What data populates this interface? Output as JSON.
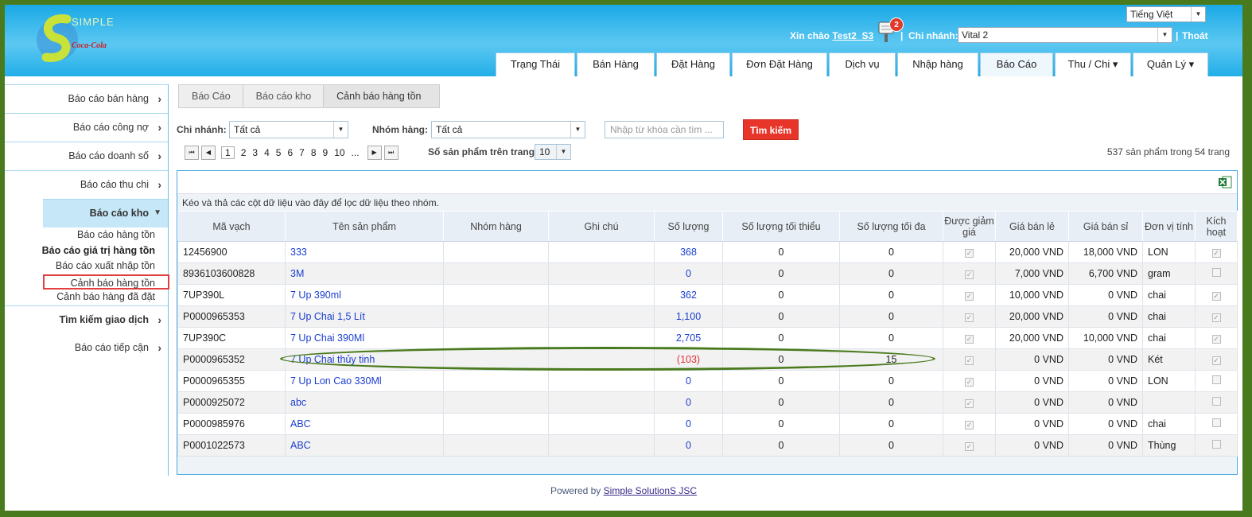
{
  "header": {
    "logo_text": "SIMPLE",
    "logo_sub": "Coca-Cola",
    "language": "Tiếng Việt",
    "greeting": "Xin chào",
    "user": "Test2_S3",
    "notifications": "2",
    "separator": "|",
    "branch_label": "Chi nhánh:",
    "branch_value": "Vital 2",
    "logout": "Thoát"
  },
  "nav": {
    "tabs": [
      {
        "label": "Trạng Thái"
      },
      {
        "label": "Bán Hàng"
      },
      {
        "label": "Đặt Hàng"
      },
      {
        "label": "Đơn Đặt Hàng"
      },
      {
        "label": "Dịch vụ"
      },
      {
        "label": "Nhập hàng"
      },
      {
        "label": "Báo Cáo"
      },
      {
        "label": "Thu / Chi ▾"
      },
      {
        "label": "Quản Lý ▾"
      }
    ]
  },
  "sidebar": {
    "items": [
      {
        "label": "Báo cáo bán hàng"
      },
      {
        "label": "Báo cáo công nợ"
      },
      {
        "label": "Báo cáo doanh số"
      },
      {
        "label": "Báo cáo thu chi"
      },
      {
        "label": "Báo cáo kho"
      },
      {
        "label": "Tìm kiếm giao dịch"
      },
      {
        "label": "Báo cáo tiếp cận"
      }
    ],
    "sub_items": [
      {
        "label": "Báo cáo hàng tồn"
      },
      {
        "label": "Báo cáo giá trị hàng tồn"
      },
      {
        "label": "Báo cáo xuất nhập tồn"
      },
      {
        "label": "Cảnh báo hàng tồn"
      },
      {
        "label": "Cảnh báo hàng đã đặt"
      }
    ]
  },
  "breadcrumb": [
    "Báo Cáo",
    "Báo cáo kho",
    "Cảnh báo hàng tồn"
  ],
  "filters": {
    "branch_label": "Chi nhánh:",
    "branch_value": "Tất cả",
    "group_label": "Nhóm hàng:",
    "group_value": "Tất cả",
    "keyword_placeholder": "Nhập từ khóa cần tìm ...",
    "search_button": "Tìm kiếm"
  },
  "pager": {
    "pages": [
      "1",
      "2",
      "3",
      "4",
      "5",
      "6",
      "7",
      "8",
      "9",
      "10",
      "..."
    ],
    "current": "1",
    "per_page_label": "Số sản phẩm trên trang:",
    "per_page_value": "10",
    "total": "537 sản phẩm trong 54 trang"
  },
  "grid": {
    "group_hint": "Kéo và thả các cột dữ liệu vào đây để lọc dữ liệu theo nhóm.",
    "columns": [
      "Mã vạch",
      "Tên sản phẩm",
      "Nhóm hàng",
      "Ghi chú",
      "Số lượng",
      "Số lượng tối thiểu",
      "Số lượng tối đa",
      "Được giảm giá",
      "Giá bán lẻ",
      "Giá bán sỉ",
      "Đơn vị tính",
      "Kích hoạt"
    ],
    "rows": [
      {
        "barcode": "12456900",
        "name": "333",
        "group": "",
        "note": "",
        "qty": "368",
        "min": "0",
        "max": "0",
        "discount": true,
        "retail": "20,000 VND",
        "wholesale": "18,000 VND",
        "unit": "LON",
        "active": true
      },
      {
        "barcode": "8936103600828",
        "name": "3M",
        "group": "",
        "note": "",
        "qty": "0",
        "min": "0",
        "max": "0",
        "discount": true,
        "retail": "7,000 VND",
        "wholesale": "6,700 VND",
        "unit": "gram",
        "active": false
      },
      {
        "barcode": "7UP390L",
        "name": "7 Up 390ml",
        "group": "",
        "note": "",
        "qty": "362",
        "min": "0",
        "max": "0",
        "discount": true,
        "retail": "10,000 VND",
        "wholesale": "0 VND",
        "unit": "chai",
        "active": true
      },
      {
        "barcode": "P0000965353",
        "name": "7 Up Chai 1,5 Lít",
        "group": "",
        "note": "",
        "qty": "1,100",
        "min": "0",
        "max": "0",
        "discount": true,
        "retail": "20,000 VND",
        "wholesale": "0 VND",
        "unit": "chai",
        "active": true
      },
      {
        "barcode": "7UP390C",
        "name": "7 Up Chai 390Ml",
        "group": "",
        "note": "",
        "qty": "2,705",
        "min": "0",
        "max": "0",
        "discount": true,
        "retail": "20,000 VND",
        "wholesale": "10,000 VND",
        "unit": "chai",
        "active": true
      },
      {
        "barcode": "P0000965352",
        "name": "7 Up Chai thủy tinh",
        "group": "",
        "note": "",
        "qty": "(103)",
        "min": "0",
        "max": "15",
        "discount": true,
        "retail": "0 VND",
        "wholesale": "0 VND",
        "unit": "Két",
        "active": true
      },
      {
        "barcode": "P0000965355",
        "name": "7 Up Lon Cao 330Ml",
        "group": "",
        "note": "",
        "qty": "0",
        "min": "0",
        "max": "0",
        "discount": true,
        "retail": "0 VND",
        "wholesale": "0 VND",
        "unit": "LON",
        "active": false
      },
      {
        "barcode": "P0000925072",
        "name": "abc",
        "group": "",
        "note": "",
        "qty": "0",
        "min": "0",
        "max": "0",
        "discount": true,
        "retail": "0 VND",
        "wholesale": "0 VND",
        "unit": "",
        "active": false
      },
      {
        "barcode": "P0000985976",
        "name": "ABC",
        "group": "",
        "note": "",
        "qty": "0",
        "min": "0",
        "max": "0",
        "discount": true,
        "retail": "0 VND",
        "wholesale": "0 VND",
        "unit": "chai",
        "active": false
      },
      {
        "barcode": "P0001022573",
        "name": "ABC",
        "group": "",
        "note": "",
        "qty": "0",
        "min": "0",
        "max": "0",
        "discount": true,
        "retail": "0 VND",
        "wholesale": "0 VND",
        "unit": "Thùng",
        "active": false
      }
    ]
  },
  "footer": {
    "prefix": "Powered by",
    "link": "Simple SolutionS JSC"
  },
  "colors": {
    "frame": "#4a7a1e",
    "header": "#1aa9e6",
    "search_button": "#e8352a",
    "link": "#1a3ecf",
    "negative": "#e0303a"
  }
}
